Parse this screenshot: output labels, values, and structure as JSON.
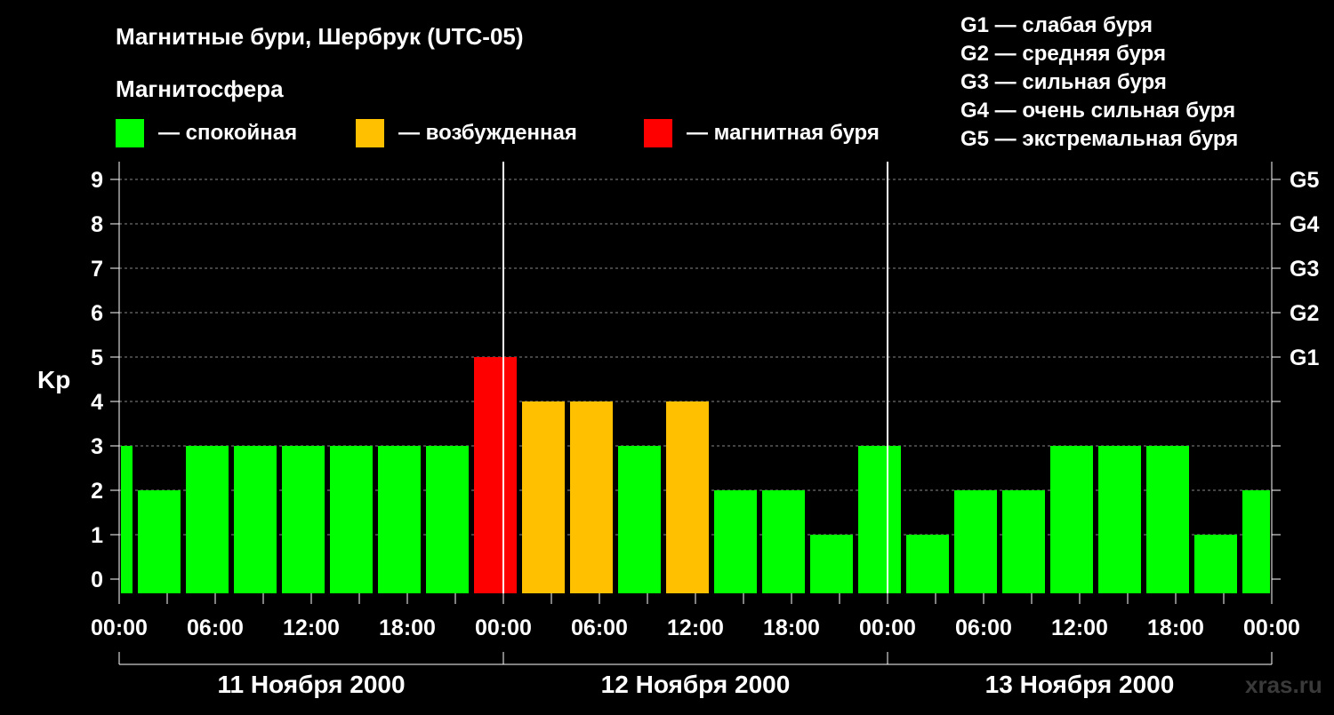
{
  "title": "Магнитные бури, Шербрук (UTC-05)",
  "legend": {
    "heading": "Магнитосфера",
    "items": [
      {
        "label": "— спокойная",
        "color": "#00ff00"
      },
      {
        "label": "— возбужденная",
        "color": "#ffc000"
      },
      {
        "label": "— магнитная буря",
        "color": "#ff0000"
      }
    ]
  },
  "g_scale": [
    "G1 — слабая буря",
    "G2 — средняя буря",
    "G3 — сильная буря",
    "G4 — очень сильная буря",
    "G5 — экстремальная буря"
  ],
  "watermark": "xras.ru",
  "chart_data": {
    "type": "bar",
    "ylabel": "Kp",
    "ylim": [
      0,
      9
    ],
    "yticks": [
      0,
      1,
      2,
      3,
      4,
      5,
      6,
      7,
      8,
      9
    ],
    "right_ticks": [
      {
        "value": 5,
        "label": "G1"
      },
      {
        "value": 6,
        "label": "G2"
      },
      {
        "value": 7,
        "label": "G3"
      },
      {
        "value": 8,
        "label": "G4"
      },
      {
        "value": 9,
        "label": "G5"
      }
    ],
    "grid": true,
    "x_tick_labels": [
      "00:00",
      "06:00",
      "12:00",
      "18:00",
      "00:00",
      "06:00",
      "12:00",
      "18:00",
      "00:00",
      "06:00",
      "12:00",
      "18:00",
      "00:00"
    ],
    "days": [
      "11 Ноября 2000",
      "12 Ноября 2000",
      "13 Ноября 2000"
    ],
    "x_range_hours": [
      0,
      72
    ],
    "colors": {
      "quiet": "#00ff00",
      "active": "#ffc000",
      "storm": "#ff0000"
    },
    "bars": [
      {
        "start_h": 0,
        "end_h": 1,
        "kp": 3,
        "level": "quiet"
      },
      {
        "start_h": 1,
        "end_h": 4,
        "kp": 2,
        "level": "quiet"
      },
      {
        "start_h": 4,
        "end_h": 7,
        "kp": 3,
        "level": "quiet"
      },
      {
        "start_h": 7,
        "end_h": 10,
        "kp": 3,
        "level": "quiet"
      },
      {
        "start_h": 10,
        "end_h": 13,
        "kp": 3,
        "level": "quiet"
      },
      {
        "start_h": 13,
        "end_h": 16,
        "kp": 3,
        "level": "quiet"
      },
      {
        "start_h": 16,
        "end_h": 19,
        "kp": 3,
        "level": "quiet"
      },
      {
        "start_h": 19,
        "end_h": 22,
        "kp": 3,
        "level": "quiet"
      },
      {
        "start_h": 22,
        "end_h": 25,
        "kp": 5,
        "level": "storm"
      },
      {
        "start_h": 25,
        "end_h": 28,
        "kp": 4,
        "level": "active"
      },
      {
        "start_h": 28,
        "end_h": 31,
        "kp": 4,
        "level": "active"
      },
      {
        "start_h": 31,
        "end_h": 34,
        "kp": 3,
        "level": "quiet"
      },
      {
        "start_h": 34,
        "end_h": 37,
        "kp": 4,
        "level": "active"
      },
      {
        "start_h": 37,
        "end_h": 40,
        "kp": 2,
        "level": "quiet"
      },
      {
        "start_h": 40,
        "end_h": 43,
        "kp": 2,
        "level": "quiet"
      },
      {
        "start_h": 43,
        "end_h": 46,
        "kp": 1,
        "level": "quiet"
      },
      {
        "start_h": 46,
        "end_h": 49,
        "kp": 3,
        "level": "quiet"
      },
      {
        "start_h": 49,
        "end_h": 52,
        "kp": 1,
        "level": "quiet"
      },
      {
        "start_h": 52,
        "end_h": 55,
        "kp": 2,
        "level": "quiet"
      },
      {
        "start_h": 55,
        "end_h": 58,
        "kp": 2,
        "level": "quiet"
      },
      {
        "start_h": 58,
        "end_h": 61,
        "kp": 3,
        "level": "quiet"
      },
      {
        "start_h": 61,
        "end_h": 64,
        "kp": 3,
        "level": "quiet"
      },
      {
        "start_h": 64,
        "end_h": 67,
        "kp": 3,
        "level": "quiet"
      },
      {
        "start_h": 67,
        "end_h": 70,
        "kp": 1,
        "level": "quiet"
      },
      {
        "start_h": 70,
        "end_h": 72,
        "kp": 2,
        "level": "quiet"
      }
    ]
  }
}
